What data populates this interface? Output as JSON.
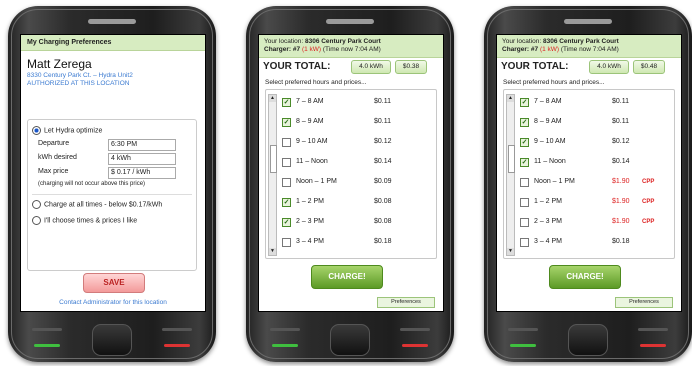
{
  "colors": {
    "accent_green": "#5c9a26",
    "header_bg": "#d7ecc1",
    "link_blue": "#3c7bd1",
    "red": "#d22222"
  },
  "phone1": {
    "title": "My Charging Preferences",
    "user_name": "Matt Zerega",
    "address": "8330 Century Park Ct. – Hydra Unit2",
    "authorized": "AUTHORIZED AT THIS LOCATION",
    "opt_hydra": "Let Hydra optimize",
    "departure_label": "Departure",
    "departure_value": "6:30 PM",
    "kwh_label": "kWh desired",
    "kwh_value": "4 kWh",
    "maxprice_label": "Max price",
    "maxprice_value": "$ 0.17 / kWh",
    "note": "(charging will not occur above this price)",
    "opt_all": "Charge at all times - below $0.17/kWh",
    "opt_choose": "I'll choose times & prices I like",
    "save": "SAVE",
    "contact": "Contact Administrator for this location"
  },
  "phone2": {
    "loc_label": "Your location:",
    "loc_value": "8306 Century Park Court",
    "charger_label": "Charger: #7",
    "charger_kw": "(1 kW)",
    "time_now": "(Time now 7:04 AM)",
    "total_label": "YOUR TOTAL:",
    "total_kwh": "4.0 kWh",
    "total_price": "$0.38",
    "select_label": "Select preferred hours and prices...",
    "items": [
      {
        "label": "7 – 8 AM",
        "price": "$0.11",
        "checked": true
      },
      {
        "label": "8 – 9 AM",
        "price": "$0.11",
        "checked": true
      },
      {
        "label": "9 – 10 AM",
        "price": "$0.12",
        "checked": false
      },
      {
        "label": "11 – Noon",
        "price": "$0.14",
        "checked": false
      },
      {
        "label": "Noon – 1 PM",
        "price": "$0.09",
        "checked": false
      },
      {
        "label": "1 – 2 PM",
        "price": "$0.08",
        "checked": true
      },
      {
        "label": "2 – 3 PM",
        "price": "$0.08",
        "checked": true
      },
      {
        "label": "3 – 4 PM",
        "price": "$0.18",
        "checked": false
      }
    ],
    "charge": "CHARGE!",
    "preferences": "Preferences"
  },
  "phone3": {
    "loc_label": "Your location:",
    "loc_value": "8306 Century Park Court",
    "charger_label": "Charger: #7",
    "charger_kw": "(1 kW)",
    "time_now": "(Time now 7:04 AM)",
    "total_label": "YOUR TOTAL:",
    "total_kwh": "4.0 kWh",
    "total_price": "$0.48",
    "select_label": "Select preferred hours and prices...",
    "items": [
      {
        "label": "7 – 8 AM",
        "price": "$0.11",
        "checked": true,
        "cpp": ""
      },
      {
        "label": "8 – 9 AM",
        "price": "$0.11",
        "checked": true,
        "cpp": ""
      },
      {
        "label": "9 – 10 AM",
        "price": "$0.12",
        "checked": true,
        "cpp": ""
      },
      {
        "label": "11 – Noon",
        "price": "$0.14",
        "checked": true,
        "cpp": ""
      },
      {
        "label": "Noon – 1 PM",
        "price": "$1.90",
        "checked": false,
        "cpp": "CPP"
      },
      {
        "label": "1 – 2 PM",
        "price": "$1.90",
        "checked": false,
        "cpp": "CPP"
      },
      {
        "label": "2 – 3 PM",
        "price": "$1.90",
        "checked": false,
        "cpp": "CPP"
      },
      {
        "label": "3 – 4 PM",
        "price": "$0.18",
        "checked": false,
        "cpp": ""
      }
    ],
    "charge": "CHARGE!",
    "preferences": "Preferences"
  }
}
